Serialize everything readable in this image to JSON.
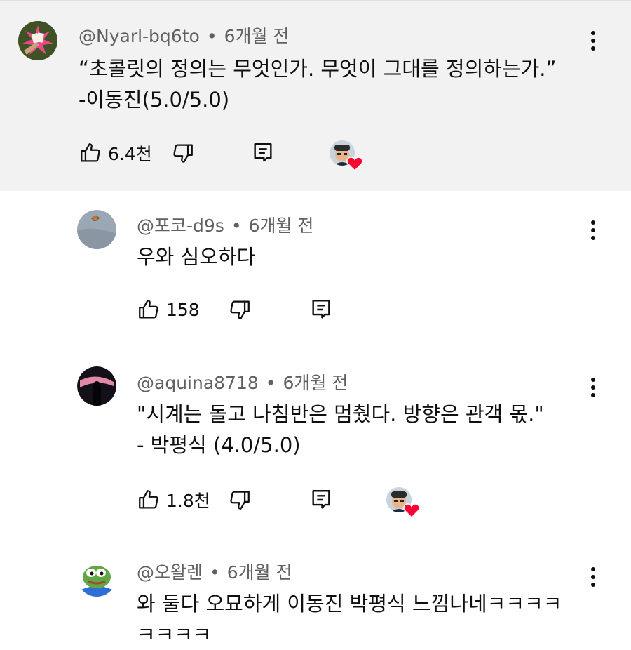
{
  "comments": [
    {
      "author": "@Nyarl-bq6to",
      "time": "6개월 전",
      "lines": [
        "“초콜릿의 정의는 무엇인가. 무엇이 그대를 정의하는가.”",
        "-이동진(5.0/5.0)"
      ],
      "likes": "6.4천",
      "creator_hearted": true
    },
    {
      "author": "@포코-d9s",
      "time": "6개월 전",
      "lines": [
        "우와 심오하다"
      ],
      "likes": "158",
      "creator_hearted": false
    },
    {
      "author": "@aquina8718",
      "time": "6개월 전",
      "lines": [
        "\"시계는 돌고 나침반은 멈췄다. 방향은 관객 몫.\"",
        "- 박평식 (4.0/5.0)"
      ],
      "likes": "1.8천",
      "creator_hearted": true
    },
    {
      "author": "@오왈렌",
      "time": "6개월 전",
      "lines": [
        "와 둘다 오묘하게 이동진 박평식 느낌나네ㅋㅋㅋㅋ",
        "ㅋㅋㅋㅋ"
      ],
      "likes": "",
      "creator_hearted": false
    }
  ],
  "meta_separator": "•",
  "icons": {
    "like": "thumb-up-icon",
    "dislike": "thumb-down-icon",
    "reply": "reply-comment-icon",
    "more": "more-vertical-icon",
    "heart": "heart-icon"
  },
  "colors": {
    "highlight_background": "#f2f2f2",
    "meta_text": "#606060",
    "heart": "#ff0033"
  }
}
